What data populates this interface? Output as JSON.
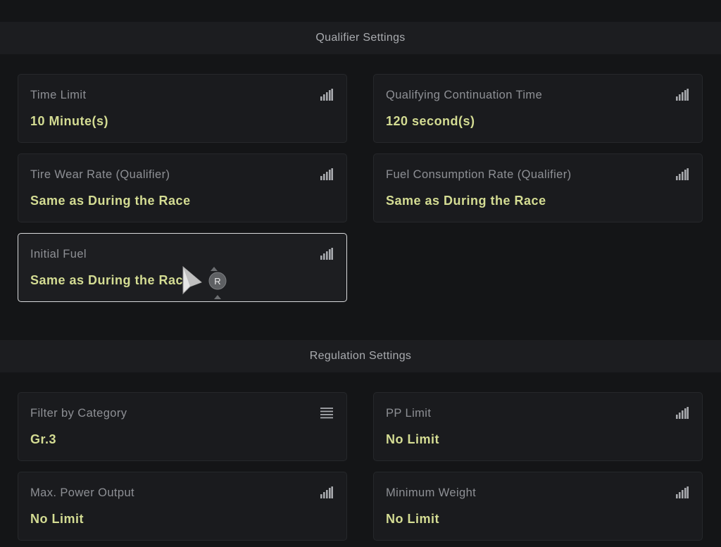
{
  "qualifier": {
    "header": "Qualifier Settings",
    "cards": [
      {
        "label": "Time Limit",
        "value": "10 Minute(s)",
        "icon": "signal-bars-icon"
      },
      {
        "label": "Qualifying Continuation Time",
        "value": "120 second(s)",
        "icon": "signal-bars-icon"
      },
      {
        "label": "Tire Wear Rate (Qualifier)",
        "value": "Same as During the Race",
        "icon": "signal-bars-icon"
      },
      {
        "label": "Fuel Consumption Rate (Qualifier)",
        "value": "Same as During the Race",
        "icon": "signal-bars-icon"
      },
      {
        "label": "Initial Fuel",
        "value": "Same as During the Race",
        "icon": "signal-bars-icon"
      }
    ]
  },
  "regulation": {
    "header": "Regulation Settings",
    "cards": [
      {
        "label": "Filter by Category",
        "value": "Gr.3",
        "icon": "list-icon"
      },
      {
        "label": "PP Limit",
        "value": "No Limit",
        "icon": "signal-bars-icon"
      },
      {
        "label": "Max. Power Output",
        "value": "No Limit",
        "icon": "signal-bars-icon"
      },
      {
        "label": "Minimum Weight",
        "value": "No Limit",
        "icon": "signal-bars-icon"
      }
    ]
  },
  "cursor": {
    "button_glyph": "R"
  },
  "colors": {
    "value_text": "#d4dc93",
    "label_text": "#8e9095",
    "selected_border": "#d9dadc",
    "background": "#141517"
  }
}
